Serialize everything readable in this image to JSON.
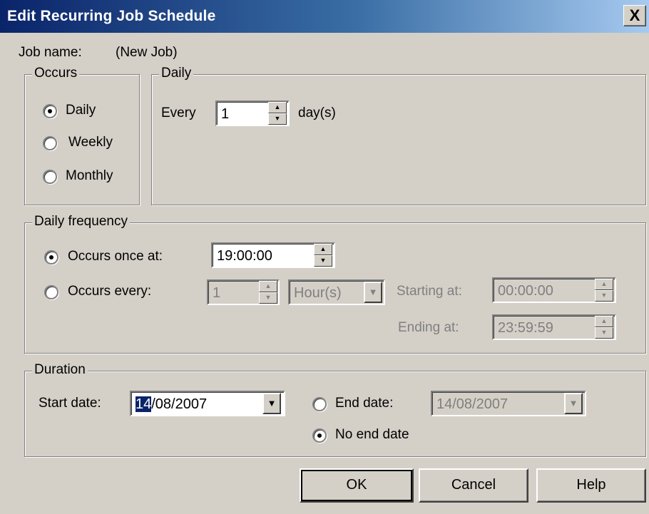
{
  "window": {
    "title": "Edit Recurring Job Schedule",
    "close_label": "X"
  },
  "job": {
    "label": "Job name:",
    "value": "(New Job)"
  },
  "occurs": {
    "title": "Occurs",
    "options": [
      {
        "label": "Daily",
        "checked": true
      },
      {
        "label": "Weekly",
        "checked": false
      },
      {
        "label": "Monthly",
        "checked": false
      }
    ]
  },
  "daily": {
    "title": "Daily",
    "every_label": "Every",
    "every_value": "1",
    "unit_label": "day(s)"
  },
  "frequency": {
    "title": "Daily frequency",
    "once_label": "Occurs once at:",
    "once_value": "19:00:00",
    "every_label": "Occurs every:",
    "every_value": "1",
    "unit_value": "Hour(s)",
    "starting_label": "Starting at:",
    "starting_value": "00:00:00",
    "ending_label": "Ending at:",
    "ending_value": "23:59:59"
  },
  "duration": {
    "title": "Duration",
    "start_label": "Start date:",
    "start_selected": "14",
    "start_rest": "/08/2007",
    "end_label": "End date:",
    "end_value": "14/08/2007",
    "no_end_label": "No end date"
  },
  "buttons": {
    "ok": "OK",
    "cancel": "Cancel",
    "help": "Help"
  }
}
